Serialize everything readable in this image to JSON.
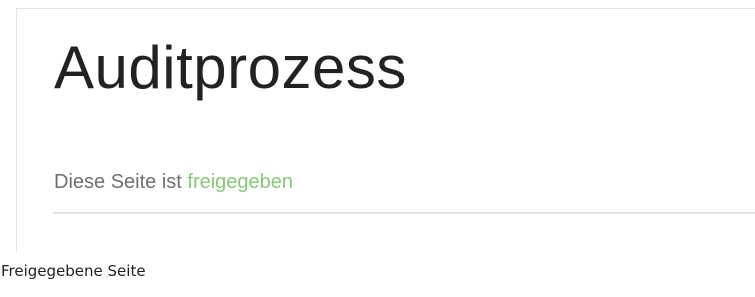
{
  "page": {
    "title": "Auditprozess",
    "status": {
      "prefix": "Diese Seite ist ",
      "link_text": "freigegeben",
      "link_color": "#87c87a",
      "text_color": "#6f6f6f"
    }
  },
  "caption": "Freigegebene Seite"
}
